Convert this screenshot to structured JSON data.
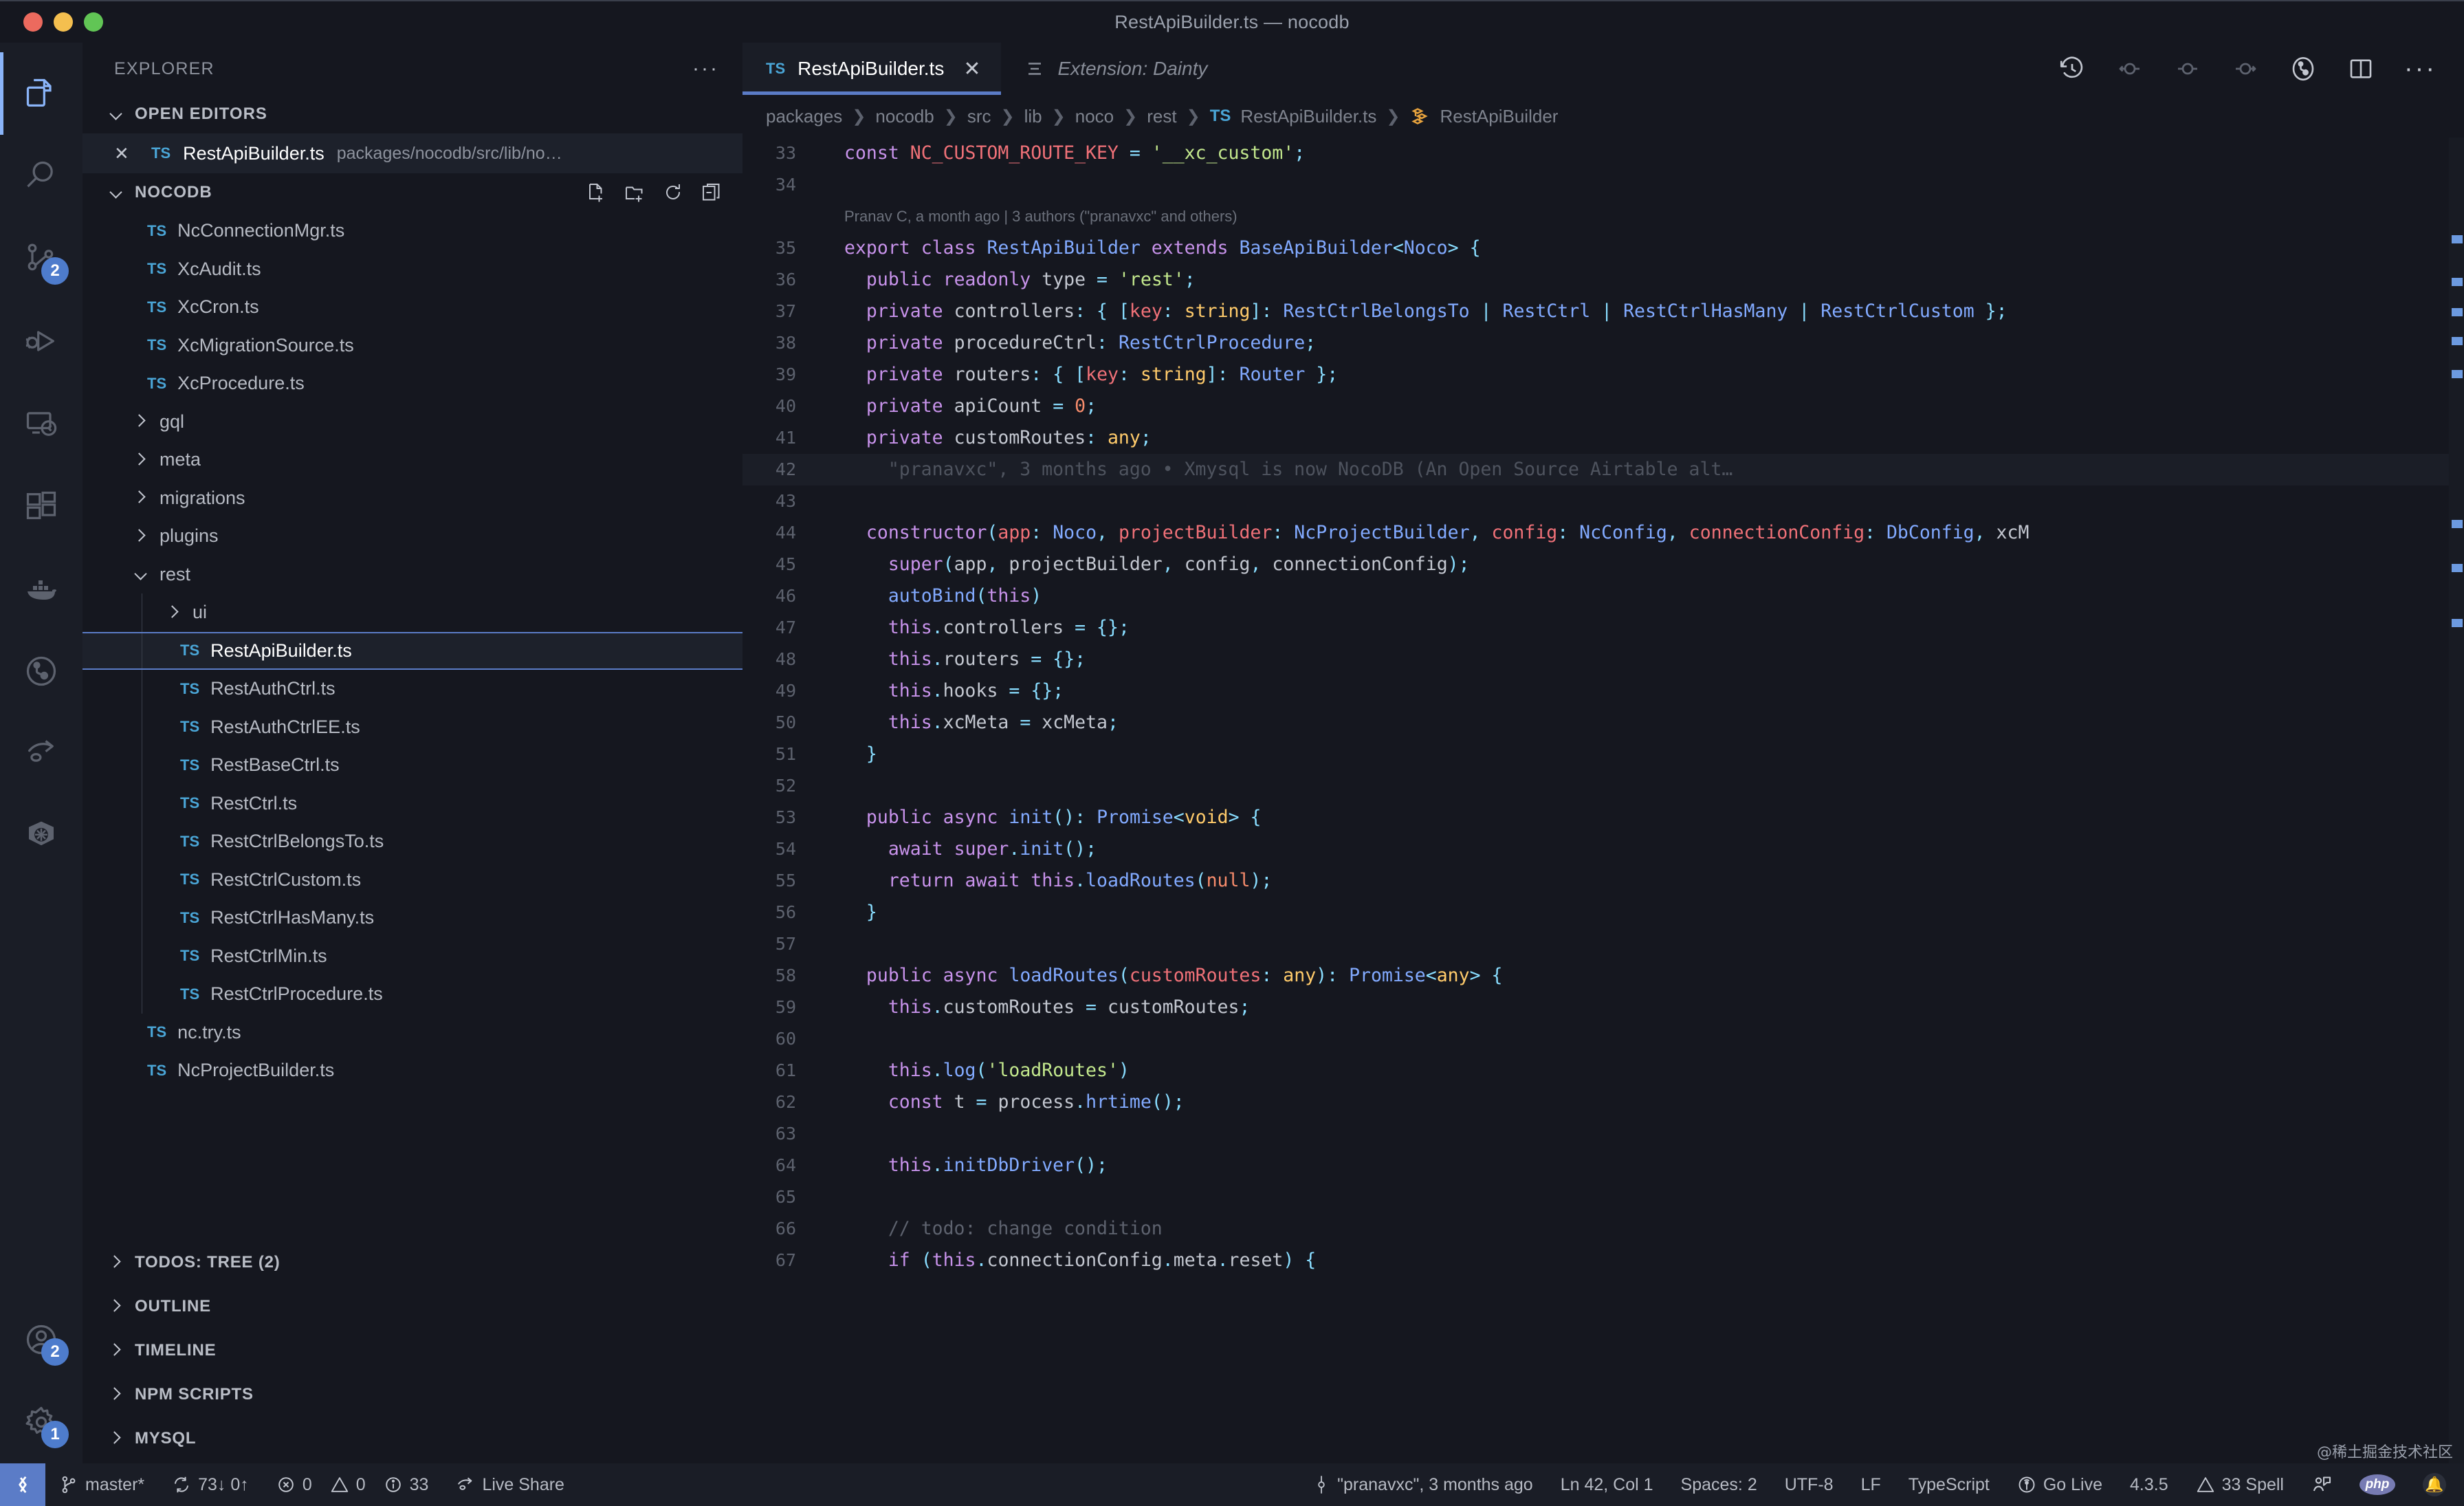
{
  "window": {
    "title": "RestApiBuilder.ts — nocodb",
    "traffic_lights": [
      "close",
      "minimize",
      "zoom"
    ]
  },
  "activity_bar": {
    "items": [
      {
        "name": "explorer",
        "icon": "files-icon",
        "active": true,
        "badge": null
      },
      {
        "name": "search",
        "icon": "search-icon",
        "active": false,
        "badge": null
      },
      {
        "name": "source-control",
        "icon": "source-control-icon",
        "active": false,
        "badge": "2"
      },
      {
        "name": "run-and-debug",
        "icon": "debug-icon",
        "active": false,
        "badge": null
      },
      {
        "name": "remote-explorer",
        "icon": "remote-icon",
        "active": false,
        "badge": null
      },
      {
        "name": "extensions",
        "icon": "extensions-icon",
        "active": false,
        "badge": null
      },
      {
        "name": "docker",
        "icon": "docker-icon",
        "active": false,
        "badge": null
      },
      {
        "name": "git-graph",
        "icon": "git-graph-icon",
        "active": false,
        "badge": null
      },
      {
        "name": "live-share",
        "icon": "live-share-icon",
        "active": false,
        "badge": null
      },
      {
        "name": "kubernetes",
        "icon": "kubernetes-icon",
        "active": false,
        "badge": null
      }
    ],
    "bottom_items": [
      {
        "name": "accounts",
        "icon": "account-icon",
        "badge": "2"
      },
      {
        "name": "manage",
        "icon": "gear-icon",
        "badge": "1"
      }
    ]
  },
  "sidebar": {
    "header_title": "EXPLORER",
    "header_more": "···",
    "open_editors": {
      "label": "OPEN EDITORS",
      "expanded": true,
      "items": [
        {
          "close": "✕",
          "icon": "TS",
          "name": "RestApiBuilder.ts",
          "path": "packages/nocodb/src/lib/no…",
          "active": true
        }
      ]
    },
    "workspace": {
      "label": "NOCODB",
      "expanded": true,
      "actions": [
        "new-file-icon",
        "new-folder-icon",
        "refresh-icon",
        "collapse-all-icon"
      ],
      "tree": [
        {
          "type": "file",
          "icon": "TS",
          "label": "NcConnectionMgr.ts",
          "depth": 2,
          "selected": false
        },
        {
          "type": "file",
          "icon": "TS",
          "label": "XcAudit.ts",
          "depth": 2,
          "selected": false
        },
        {
          "type": "file",
          "icon": "TS",
          "label": "XcCron.ts",
          "depth": 2,
          "selected": false
        },
        {
          "type": "file",
          "icon": "TS",
          "label": "XcMigrationSource.ts",
          "depth": 2,
          "selected": false
        },
        {
          "type": "file",
          "icon": "TS",
          "label": "XcProcedure.ts",
          "depth": 2,
          "selected": false
        },
        {
          "type": "folder",
          "icon": "chevron-right",
          "label": "gql",
          "depth": 2,
          "expanded": false
        },
        {
          "type": "folder",
          "icon": "chevron-right",
          "label": "meta",
          "depth": 2,
          "expanded": false
        },
        {
          "type": "folder",
          "icon": "chevron-right",
          "label": "migrations",
          "depth": 2,
          "expanded": false
        },
        {
          "type": "folder",
          "icon": "chevron-right",
          "label": "plugins",
          "depth": 2,
          "expanded": false
        },
        {
          "type": "folder",
          "icon": "chevron-down",
          "label": "rest",
          "depth": 2,
          "expanded": true
        },
        {
          "type": "folder",
          "icon": "chevron-right",
          "label": "ui",
          "depth": 3,
          "expanded": false
        },
        {
          "type": "file",
          "icon": "TS",
          "label": "RestApiBuilder.ts",
          "depth": 3,
          "selected": true
        },
        {
          "type": "file",
          "icon": "TS",
          "label": "RestAuthCtrl.ts",
          "depth": 3,
          "selected": false
        },
        {
          "type": "file",
          "icon": "TS",
          "label": "RestAuthCtrlEE.ts",
          "depth": 3,
          "selected": false
        },
        {
          "type": "file",
          "icon": "TS",
          "label": "RestBaseCtrl.ts",
          "depth": 3,
          "selected": false
        },
        {
          "type": "file",
          "icon": "TS",
          "label": "RestCtrl.ts",
          "depth": 3,
          "selected": false
        },
        {
          "type": "file",
          "icon": "TS",
          "label": "RestCtrlBelongsTo.ts",
          "depth": 3,
          "selected": false
        },
        {
          "type": "file",
          "icon": "TS",
          "label": "RestCtrlCustom.ts",
          "depth": 3,
          "selected": false
        },
        {
          "type": "file",
          "icon": "TS",
          "label": "RestCtrlHasMany.ts",
          "depth": 3,
          "selected": false
        },
        {
          "type": "file",
          "icon": "TS",
          "label": "RestCtrlMin.ts",
          "depth": 3,
          "selected": false
        },
        {
          "type": "file",
          "icon": "TS",
          "label": "RestCtrlProcedure.ts",
          "depth": 3,
          "selected": false
        },
        {
          "type": "file",
          "icon": "TS",
          "label": "nc.try.ts",
          "depth": 2,
          "selected": false
        },
        {
          "type": "file",
          "icon": "TS",
          "label": "NcProjectBuilder.ts",
          "depth": 2,
          "selected": false
        }
      ]
    },
    "bottom_sections": [
      {
        "label": "TODOS: TREE (2)",
        "expanded": false
      },
      {
        "label": "OUTLINE",
        "expanded": false
      },
      {
        "label": "TIMELINE",
        "expanded": false
      },
      {
        "label": "NPM SCRIPTS",
        "expanded": false
      },
      {
        "label": "MYSQL",
        "expanded": false
      }
    ]
  },
  "editor": {
    "tabs": [
      {
        "icon": "TS",
        "label": "RestApiBuilder.ts",
        "close": "✕",
        "active": true,
        "italic": false
      },
      {
        "icon": "list-icon",
        "label": "Extension: Dainty",
        "close": "",
        "active": false,
        "italic": true
      }
    ],
    "toolbar_icons": [
      "history-icon",
      "previous-change-icon",
      "current-change-icon",
      "next-change-icon",
      "git-compare-icon",
      "split-editor-icon",
      "more-actions-icon"
    ],
    "breadcrumb": [
      "packages",
      "nocodb",
      "src",
      "lib",
      "noco",
      "rest",
      "RestApiBuilder.ts",
      "RestApiBuilder"
    ],
    "breadcrumb_file_icon": "TS",
    "breadcrumb_symbol_icon": "class-icon",
    "blame_header": "Pranav C, a month ago | 3 authors (\"pranavxc\" and others)",
    "inline_blame": "\"pranavxc\", 3 months ago • Xmysql is now NocoDB (An Open Source Airtable alt…",
    "lines": [
      {
        "n": 33,
        "text": "const NC_CUSTOM_ROUTE_KEY = '__xc_custom';"
      },
      {
        "n": 34,
        "text": ""
      },
      {
        "n": 35,
        "text": "export class RestApiBuilder extends BaseApiBuilder<Noco> {"
      },
      {
        "n": 36,
        "text": "  public readonly type = 'rest';"
      },
      {
        "n": 37,
        "text": "  private controllers: { [key: string]: RestCtrlBelongsTo | RestCtrl | RestCtrlHasMany | RestCtrlCustom };"
      },
      {
        "n": 38,
        "text": "  private procedureCtrl: RestCtrlProcedure;"
      },
      {
        "n": 39,
        "text": "  private routers: { [key: string]: Router };"
      },
      {
        "n": 40,
        "text": "  private apiCount = 0;"
      },
      {
        "n": 41,
        "text": "  private customRoutes: any;"
      },
      {
        "n": 42,
        "text": ""
      },
      {
        "n": 43,
        "text": ""
      },
      {
        "n": 44,
        "text": "  constructor(app: Noco, projectBuilder: NcProjectBuilder, config: NcConfig, connectionConfig: DbConfig, xcM"
      },
      {
        "n": 45,
        "text": "    super(app, projectBuilder, config, connectionConfig);"
      },
      {
        "n": 46,
        "text": "    autoBind(this)"
      },
      {
        "n": 47,
        "text": "    this.controllers = {};"
      },
      {
        "n": 48,
        "text": "    this.routers = {};"
      },
      {
        "n": 49,
        "text": "    this.hooks = {};"
      },
      {
        "n": 50,
        "text": "    this.xcMeta = xcMeta;"
      },
      {
        "n": 51,
        "text": "  }"
      },
      {
        "n": 52,
        "text": ""
      },
      {
        "n": 53,
        "text": "  public async init(): Promise<void> {"
      },
      {
        "n": 54,
        "text": "    await super.init();"
      },
      {
        "n": 55,
        "text": "    return await this.loadRoutes(null);"
      },
      {
        "n": 56,
        "text": "  }"
      },
      {
        "n": 57,
        "text": ""
      },
      {
        "n": 58,
        "text": "  public async loadRoutes(customRoutes: any): Promise<any> {"
      },
      {
        "n": 59,
        "text": "    this.customRoutes = customRoutes;"
      },
      {
        "n": 60,
        "text": ""
      },
      {
        "n": 61,
        "text": "    this.log('loadRoutes')"
      },
      {
        "n": 62,
        "text": "    const t = process.hrtime();"
      },
      {
        "n": 63,
        "text": ""
      },
      {
        "n": 64,
        "text": "    this.initDbDriver();"
      },
      {
        "n": 65,
        "text": ""
      },
      {
        "n": 66,
        "text": "    // todo: change condition"
      },
      {
        "n": 67,
        "text": "    if (this.connectionConfig.meta.reset) {"
      }
    ]
  },
  "status_bar": {
    "remote_icon": "remote-window-icon",
    "left": [
      {
        "name": "branch",
        "icon": "git-branch-icon",
        "text": "master*"
      },
      {
        "name": "sync",
        "icon": "sync-icon",
        "text": "73↓ 0↑"
      },
      {
        "name": "problems",
        "icon": "error-icon",
        "text": "0",
        "icon2": "warning-icon",
        "text2": "0",
        "icon3": "info-icon",
        "text3": "33"
      },
      {
        "name": "live-share",
        "icon": "live-share-icon",
        "text": "Live Share"
      }
    ],
    "right": [
      {
        "name": "git-blame",
        "icon": "git-commit-icon",
        "text": "\"pranavxc\", 3 months ago"
      },
      {
        "name": "cursor-position",
        "icon": "",
        "text": "Ln 42, Col 1"
      },
      {
        "name": "indentation",
        "icon": "",
        "text": "Spaces: 2"
      },
      {
        "name": "encoding",
        "icon": "",
        "text": "UTF-8"
      },
      {
        "name": "eol",
        "icon": "",
        "text": "LF"
      },
      {
        "name": "language-mode",
        "icon": "",
        "text": "TypeScript"
      },
      {
        "name": "go-live",
        "icon": "broadcast-icon",
        "text": "Go Live"
      },
      {
        "name": "ts-version",
        "icon": "",
        "text": "4.3.5"
      },
      {
        "name": "spell-checker",
        "icon": "warning-icon",
        "text": "33 Spell"
      },
      {
        "name": "feedback",
        "icon": "feedback-icon",
        "text": ""
      },
      {
        "name": "php-tools",
        "icon": "php-icon",
        "text": "php"
      },
      {
        "name": "notifications",
        "icon": "bell-icon",
        "text": ""
      }
    ],
    "watermark": "@稀土掘金技术社区"
  },
  "colors": {
    "accent": "#5b7cc7",
    "bg": "#15171f",
    "panel": "#1a1d26",
    "selection": "#1d212b",
    "ts_blue": "#4aa5d6",
    "badge": "#4e7ccc"
  }
}
